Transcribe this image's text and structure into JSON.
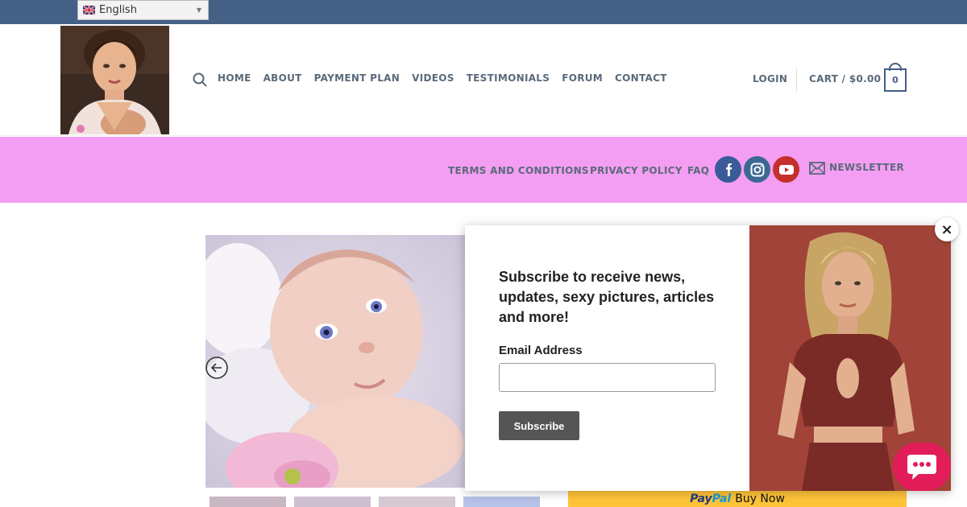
{
  "topbar": {
    "language": "English"
  },
  "nav": {
    "items": [
      "HOME",
      "ABOUT",
      "PAYMENT PLAN",
      "VIDEOS",
      "TESTIMONIALS",
      "FORUM",
      "CONTACT"
    ],
    "login": "LOGIN",
    "cart_label": "CART / $0.00",
    "cart_count": "0"
  },
  "secondary_nav": {
    "terms": "TERMS AND CONDITIONS",
    "privacy": "PRIVACY POLICY",
    "faq": "FAQ",
    "newsletter": "NEWSLETTER"
  },
  "social": {
    "facebook_color": "#3a5a98",
    "instagram_color": "#3b6994",
    "youtube_color": "#c4302b"
  },
  "colors": {
    "topbar": "#446084",
    "pinkbar": "#f49ef3",
    "chat": "#e21d5a",
    "paypal": "#ffc439"
  },
  "popup": {
    "title": "Subscribe to receive news, updates, sexy pictures, articles and more!",
    "email_label": "Email Address",
    "email_value": "",
    "subscribe_label": "Subscribe",
    "close_label": "×"
  },
  "paypal": {
    "pay": "Pay",
    "pal": "Pal",
    "buy_now": "Buy Now"
  }
}
